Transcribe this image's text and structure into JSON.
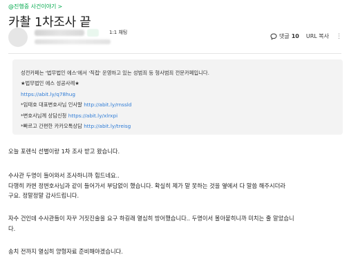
{
  "board": {
    "label": "@진행중 사건이야기",
    "chevron": ">"
  },
  "post": {
    "title": "카촬 1차조사 끝"
  },
  "author": {
    "chat_label": "1:1 채팅"
  },
  "tools": {
    "comment_label": "댓글",
    "comment_count": "10",
    "url_copy_label": "URL 복사",
    "more_glyph": "⋮"
  },
  "notice": {
    "intro": "성전카페는 '법무법인 에스'에서 '직접' 운영하고 있는 성범죄 등 형사범죄 전문카페입니다.",
    "cases_label": "★법무법인 에스 성공사례★",
    "cases_url": "https://abit.ly/q78hug",
    "greeting_label": "*임태호 대표변호사님 인사말",
    "greeting_url": "http://abit.ly/rnssld",
    "consult_label": "*변호사님께 상담신청",
    "consult_url": "https://abit.ly/xlrxpi",
    "kakao_label": "*빠르고 간편한 카카오톡상담",
    "kakao_url": "http://abit.ly/treisg"
  },
  "body": {
    "p1": "오늘 포렌식 선별이랑 1차 조사 받고 왔습니다.",
    "p2_l1": "수사관 두명이 들어와서 조사하니까 힘드네요..",
    "p2_l2": "다행히 카변 정변호사님과 같이 들어가서 부담없이 했습니다. 확실히 제가 말 못하는 것을 옆에서 다 말씀 해주시더라",
    "p2_l3": "구요. 정말정말 감사드립니다.",
    "p3": "자수 건인데 수사관들이 자꾸 거짓진술을 요구 하길래 열심히 방어했습니다.. 두명이서 몰아붙히니까 미치는 줄 알았습니",
    "p3_l2": "다.",
    "p4": "송치 전까지 열심히 양형자료 준비해야겠습니다."
  },
  "colors": {
    "accent": "#03a94d",
    "link": "#2d7bd6",
    "notice_bg": "#f3f3f3"
  },
  "icons": {
    "comment": "speech-bubble-icon",
    "url": "link-icon",
    "more": "more-vertical-icon"
  }
}
